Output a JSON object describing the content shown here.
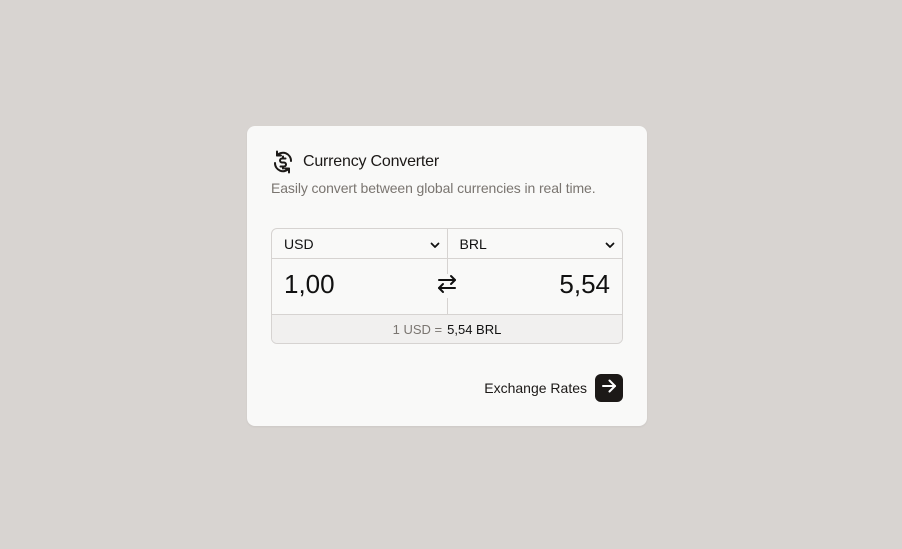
{
  "card": {
    "title": "Currency Converter",
    "subtitle": "Easily convert between global currencies in real time."
  },
  "converter": {
    "from_currency": "USD",
    "to_currency": "BRL",
    "from_amount": "1,00",
    "to_amount": "5,54",
    "rate_prefix": "1 USD =",
    "rate_value": "5,54 BRL"
  },
  "footer": {
    "link_label": "Exchange Rates"
  },
  "icons": {
    "title": "currency-exchange-icon",
    "swap": "swap-arrows-icon",
    "arrow": "arrow-right-icon",
    "chevron": "chevron-down-icon"
  },
  "colors": {
    "background": "#d8d4d1",
    "card": "#f9f9f8",
    "accent": "#1c1917",
    "muted_text": "#7a7570",
    "border": "#d6d3d1"
  }
}
